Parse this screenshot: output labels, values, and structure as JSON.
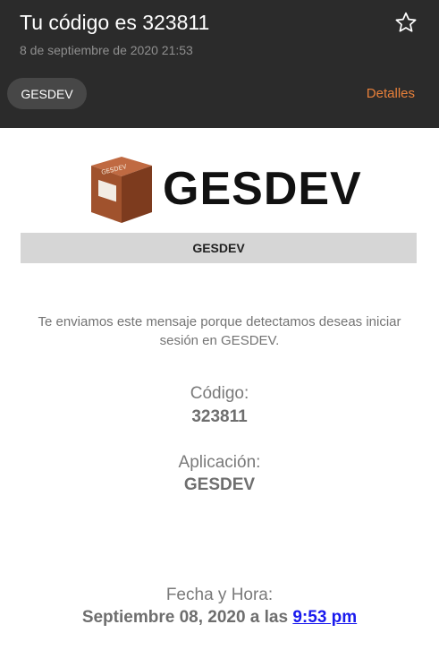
{
  "header": {
    "subject": "Tu código es 323811",
    "date": "8 de septiembre de 2020  21:53",
    "sender": "GESDEV",
    "details_label": "Detalles",
    "colors": {
      "background": "#2b2b2b",
      "chip": "#474747",
      "accent": "#e8803a"
    }
  },
  "email": {
    "logo_text": "GESDEV",
    "banner_text": "GESDEV",
    "intro": "Te enviamos este mensaje porque detectamos deseas iniciar sesión en GESDEV.",
    "code_label": "Código:",
    "code_value": "323811",
    "app_label": "Aplicación:",
    "app_value": "GESDEV",
    "datetime_label": "Fecha y Hora:",
    "datetime_prefix": "Septiembre 08, 2020 a las ",
    "datetime_time": "9:53 pm",
    "colors": {
      "banner": "#d6d6d6",
      "link": "#1a1aee",
      "logo_box": "#a0522d"
    }
  },
  "icons": {
    "star": "star-outline-icon",
    "logo": "package-box-icon"
  }
}
